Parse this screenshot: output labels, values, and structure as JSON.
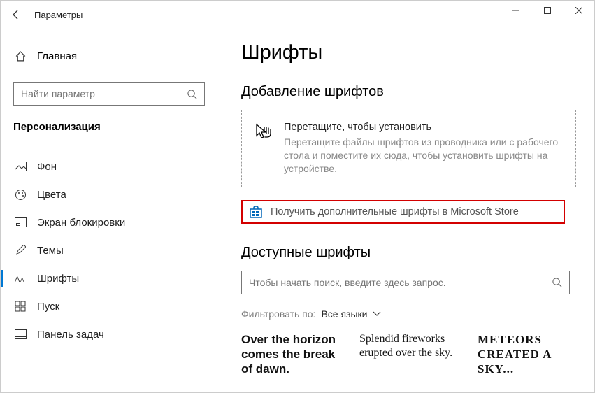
{
  "titlebar": {
    "title": "Параметры"
  },
  "sidebar": {
    "home": "Главная",
    "search_placeholder": "Найти параметр",
    "section": "Персонализация",
    "items": [
      {
        "label": "Фон"
      },
      {
        "label": "Цвета"
      },
      {
        "label": "Экран блокировки"
      },
      {
        "label": "Темы"
      },
      {
        "label": "Шрифты"
      },
      {
        "label": "Пуск"
      },
      {
        "label": "Панель задач"
      }
    ]
  },
  "main": {
    "title": "Шрифты",
    "add_title": "Добавление шрифтов",
    "drop_title": "Перетащите, чтобы установить",
    "drop_desc": "Перетащите файлы шрифтов из проводника или с рабочего стола и поместите их сюда, чтобы установить шрифты на устройстве.",
    "store_link": "Получить дополнительные шрифты в Microsoft Store",
    "avail_title": "Доступные шрифты",
    "search_placeholder": "Чтобы начать поиск, введите здесь запрос.",
    "filter_label": "Фильтровать по:",
    "filter_value": "Все языки",
    "samples": [
      "Over the horizon comes the break of dawn.",
      "Splendid fireworks erupted over the sky.",
      "METEORS CREATED A SKY..."
    ]
  }
}
